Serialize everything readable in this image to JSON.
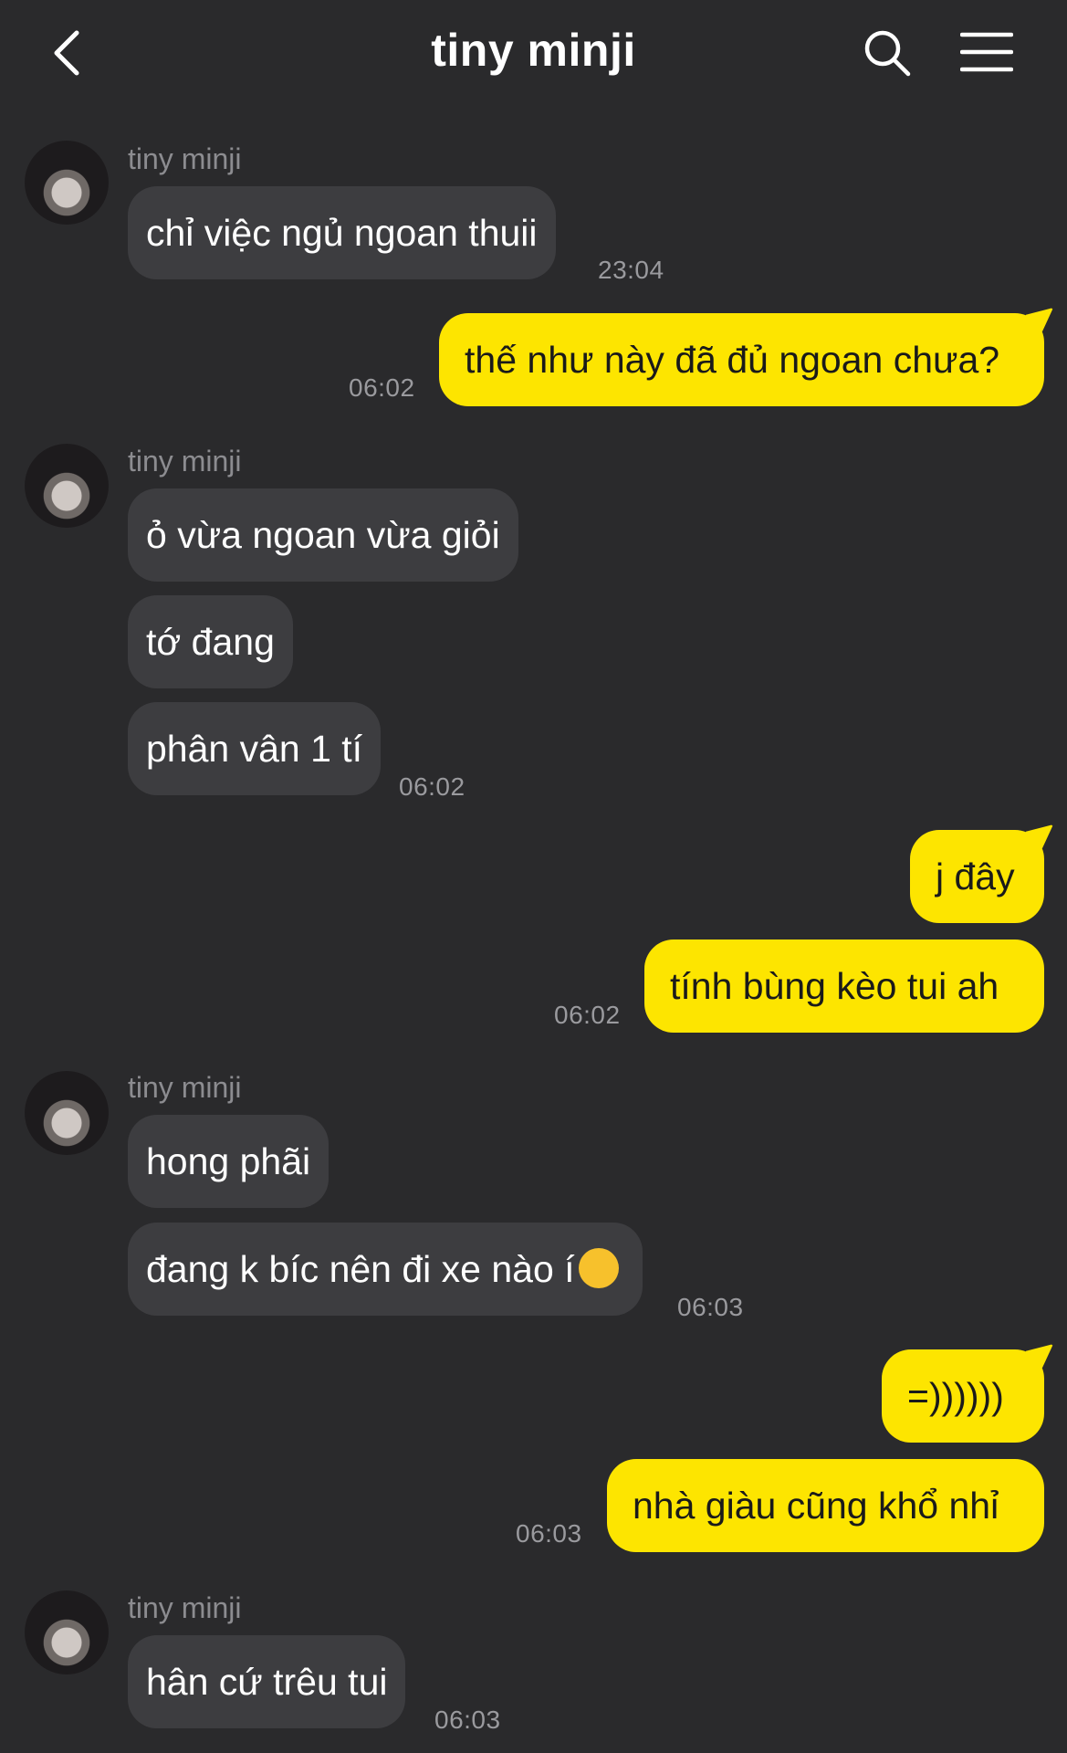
{
  "header": {
    "title": "tiny minji",
    "back_icon": "chevron-left-icon",
    "search_icon": "search-icon",
    "menu_icon": "hamburger-menu-icon"
  },
  "colors": {
    "background": "#2a2a2c",
    "incoming_bubble": "#3d3d40",
    "outgoing_bubble": "#fde500",
    "timestamp": "#9a9a9e"
  },
  "contact_name": "tiny minji",
  "messages": [
    {
      "from": "them",
      "text": "chỉ việc ngủ ngoan thuii",
      "time": "23:04"
    },
    {
      "from": "me",
      "text": "thế như này đã đủ ngoan chưa?",
      "time": "06:02"
    },
    {
      "from": "them",
      "text": "ỏ vừa ngoan vừa giỏi"
    },
    {
      "from": "them",
      "text": "tớ đang"
    },
    {
      "from": "them",
      "text": "phân vân 1 tí",
      "time": "06:02"
    },
    {
      "from": "me",
      "text": "j đây"
    },
    {
      "from": "me",
      "text": "tính bùng kèo tui ah",
      "time": "06:02"
    },
    {
      "from": "them",
      "text": "hong phãi"
    },
    {
      "from": "them",
      "text": "đang k bíc nên đi xe nào í",
      "emoji": "pensive-face-emoji",
      "time": "06:03"
    },
    {
      "from": "me",
      "text": "=))))))"
    },
    {
      "from": "me",
      "text": "nhà giàu cũng khổ nhỉ",
      "time": "06:03"
    },
    {
      "from": "them",
      "text": "hân cứ trêu tui",
      "time": "06:03"
    }
  ]
}
